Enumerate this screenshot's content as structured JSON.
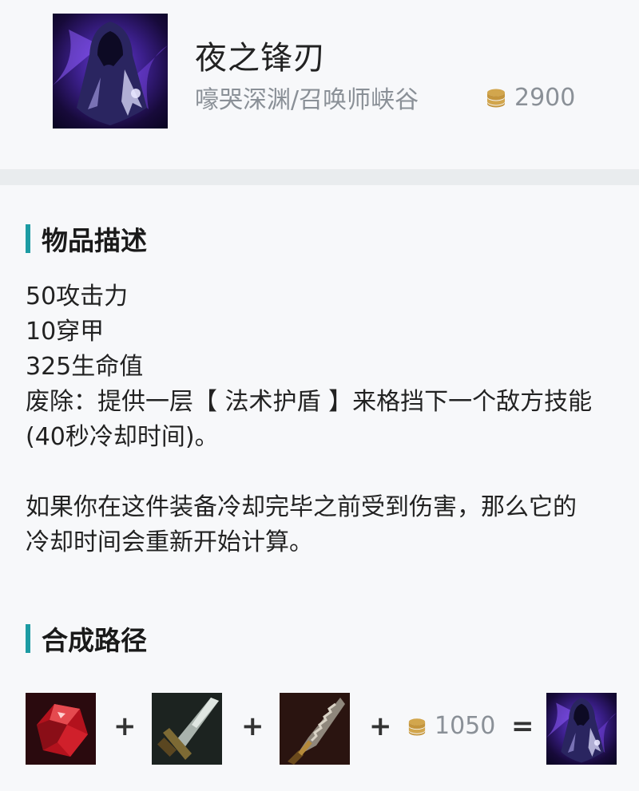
{
  "item": {
    "name": "夜之锋刃",
    "maps": "嚎哭深渊/召唤师峡谷",
    "cost": "2900",
    "icon": "edge-of-night-icon"
  },
  "description_section": {
    "title": "物品描述",
    "lines": [
      "50攻击力",
      "10穿甲",
      "325生命值",
      "废除：提供一层【 法术护盾 】来格挡下一个敌方技能",
      "(40秒冷却时间)。",
      "",
      "如果你在这件装备冷却完毕之前受到伤害，那么它的",
      "冷却时间会重新开始计算。"
    ]
  },
  "recipe_section": {
    "title": "合成路径",
    "components": [
      {
        "icon": "ruby-crystal-icon"
      },
      {
        "icon": "long-sword-icon"
      },
      {
        "icon": "serrated-dirk-icon"
      }
    ],
    "plus": "+",
    "combine_cost": "1050",
    "equals": "=",
    "result": {
      "icon": "edge-of-night-icon"
    }
  },
  "colors": {
    "accent_bar": "#1d9ba3",
    "gold_coin": "#d2a64d",
    "muted_text": "#8a9097"
  }
}
